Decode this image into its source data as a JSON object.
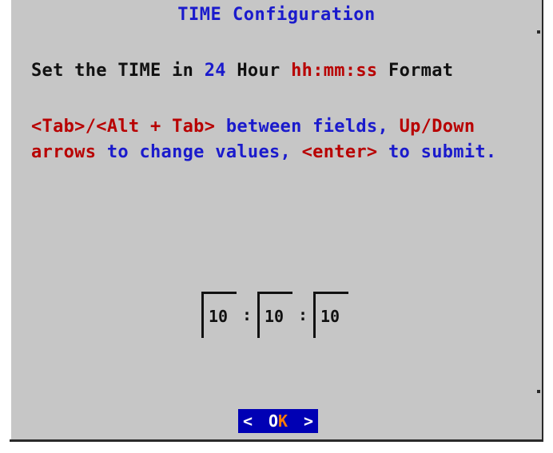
{
  "dialog": {
    "title": "TIME Configuration",
    "instruction": {
      "part1": "Set the TIME in ",
      "hours": "24",
      "part2": " Hour ",
      "format": "hh:mm:ss",
      "part3": " Format"
    },
    "help_line1": {
      "keys": "<Tab>/<Alt + Tab>",
      "text": " between fields, ",
      "arrows": "Up/Down"
    },
    "help_line2": {
      "arrows": "arrows",
      "text": " to change values, ",
      "enter": "<enter>",
      "text2": " to submit."
    }
  },
  "time_fields": {
    "hours": "10",
    "minutes": "10",
    "seconds": "10",
    "separator": ":"
  },
  "ok_button": {
    "left": "<",
    "label_o": "O",
    "label_k": "K",
    "right": ">"
  },
  "colors": {
    "dialog_bg": "#c6c6c6",
    "accent_blue": "#1a1acc",
    "accent_red": "#b80000",
    "button_bg": "#0000b4",
    "hotkey": "#ff7a00"
  }
}
